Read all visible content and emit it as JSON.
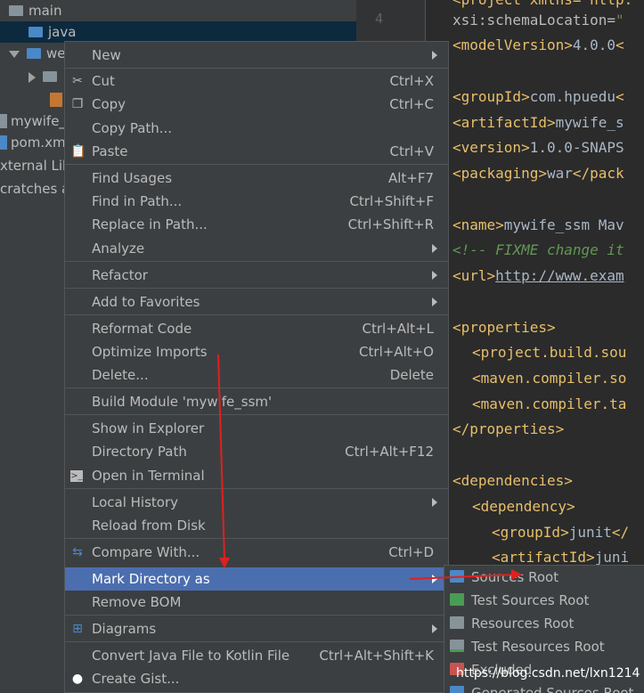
{
  "tree": {
    "rows": [
      "main",
      "java",
      "we",
      "mywife_s",
      "pom.xml",
      "xternal Lib",
      "cratches ar"
    ]
  },
  "editor": {
    "line_numbers": [
      "4"
    ],
    "lines": {
      "l0": {
        "text": "<project xmlns=\"http:"
      },
      "l1_attr": "xsi:schemaLocation=",
      "l1_str": "\"",
      "l2_open": "<modelVersion>",
      "l2_text": "4.0.0",
      "l2_close": "<",
      "l3_open": "<groupId>",
      "l3_text": "com.hpuedu",
      "l3_close": "<",
      "l4_open": "<artifactId>",
      "l4_text": "mywife_s",
      "l5_open": "<version>",
      "l5_text": "1.0.0-SNAPS",
      "l6_open": "<packaging>",
      "l6_text": "war",
      "l6_close": "</pack",
      "l7_open": "<name>",
      "l7_text": "mywife_ssm Mav",
      "l8_cmt": "<!-- ",
      "l8_text": "FIXME change it",
      "l9_open": "<url>",
      "l9_text": "http://www.exam",
      "l10": "<properties>",
      "l11_open": "<project.build.sou",
      "l12_open": "<maven.compiler.so",
      "l13_open": "<maven.compiler.ta",
      "l14": "</properties>",
      "l15": "<dependencies>",
      "l16": "<dependency>",
      "l17_open": "<groupId>",
      "l17_text": "junit",
      "l17_close": "</",
      "l18_open": "<artifactId>",
      "l18_text": "juni"
    }
  },
  "menu": {
    "items": [
      {
        "label": "New",
        "shortcut": "",
        "submenu": true
      },
      {
        "label": "Cut",
        "shortcut": "Ctrl+X",
        "icon": "scissors-icon"
      },
      {
        "label": "Copy",
        "shortcut": "Ctrl+C",
        "icon": "copy-icon"
      },
      {
        "label": "Copy Path...",
        "shortcut": ""
      },
      {
        "label": "Paste",
        "shortcut": "Ctrl+V",
        "icon": "paste-icon"
      },
      {
        "label": "Find Usages",
        "shortcut": "Alt+F7"
      },
      {
        "label": "Find in Path...",
        "shortcut": "Ctrl+Shift+F"
      },
      {
        "label": "Replace in Path...",
        "shortcut": "Ctrl+Shift+R"
      },
      {
        "label": "Analyze",
        "shortcut": "",
        "submenu": true
      },
      {
        "label": "Refactor",
        "shortcut": "",
        "submenu": true
      },
      {
        "label": "Add to Favorites",
        "shortcut": "",
        "submenu": true
      },
      {
        "label": "Reformat Code",
        "shortcut": "Ctrl+Alt+L"
      },
      {
        "label": "Optimize Imports",
        "shortcut": "Ctrl+Alt+O"
      },
      {
        "label": "Delete...",
        "shortcut": "Delete"
      },
      {
        "label": "Build Module 'mywife_ssm'",
        "shortcut": ""
      },
      {
        "label": "Show in Explorer",
        "shortcut": ""
      },
      {
        "label": "Directory Path",
        "shortcut": "Ctrl+Alt+F12"
      },
      {
        "label": "Open in Terminal",
        "shortcut": "",
        "icon": "terminal-icon"
      },
      {
        "label": "Local History",
        "shortcut": "",
        "submenu": true
      },
      {
        "label": "Reload from Disk",
        "shortcut": ""
      },
      {
        "label": "Compare With...",
        "shortcut": "Ctrl+D",
        "icon": "compare-icon"
      },
      {
        "label": "Mark Directory as",
        "shortcut": "",
        "submenu": true,
        "highlighted": true
      },
      {
        "label": "Remove BOM",
        "shortcut": ""
      },
      {
        "label": "Diagrams",
        "shortcut": "",
        "submenu": true,
        "icon": "diagram-icon"
      },
      {
        "label": "Convert Java File to Kotlin File",
        "shortcut": "Ctrl+Alt+Shift+K"
      },
      {
        "label": "Create Gist...",
        "shortcut": "",
        "icon": "github-icon"
      }
    ]
  },
  "submenu": {
    "items": [
      {
        "label": "Sources Root",
        "color": "#4a88c7"
      },
      {
        "label": "Test Sources Root",
        "color": "#499c54"
      },
      {
        "label": "Resources Root",
        "color": "#87939a"
      },
      {
        "label": "Test Resources Root",
        "color": "#87939a"
      },
      {
        "label": "Excluded",
        "color": "#c75450"
      },
      {
        "label": "Generated Sources Root",
        "color": "#4a88c7"
      }
    ]
  },
  "watermark": "https://blog.csdn.net/lxn1214",
  "colors": {
    "highlight": "#4b6eaf",
    "annotation_red": "#e02020"
  }
}
